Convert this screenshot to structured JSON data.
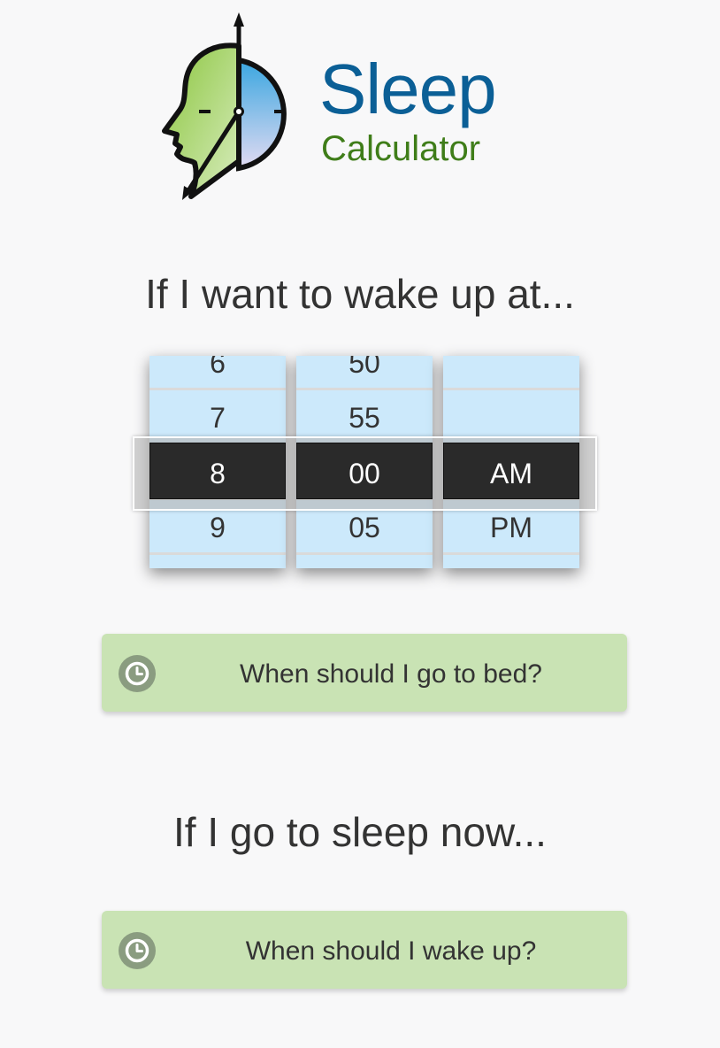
{
  "logo": {
    "title": "Sleep",
    "subtitle": "Calculator",
    "icon": "head-clock-logo"
  },
  "wake_section": {
    "heading": "If I want to wake up at...",
    "picker": {
      "hour": {
        "items": [
          "6",
          "7",
          "8",
          "9",
          ""
        ],
        "selected": "8"
      },
      "minute": {
        "items": [
          "50",
          "55",
          "00",
          "05",
          ""
        ],
        "selected": "00"
      },
      "period": {
        "items": [
          "",
          "",
          "AM",
          "PM",
          ""
        ],
        "selected": "AM"
      }
    },
    "button": {
      "label": "When should I go to bed?",
      "icon": "clock-icon"
    }
  },
  "sleep_section": {
    "heading": "If I go to sleep now...",
    "button": {
      "label": "When should I wake up?",
      "icon": "clock-icon"
    }
  },
  "colors": {
    "background": "#f8f8f9",
    "logo_title": "#0b5f96",
    "logo_subtitle": "#3f7d19",
    "wheel_background": "#cce9fb",
    "selected_cell": "#2a2a2a",
    "button_background": "#c9e3b4",
    "button_icon": "#8a9c80"
  }
}
